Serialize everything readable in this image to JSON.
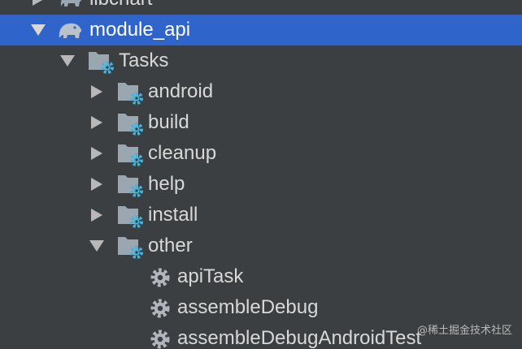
{
  "colors": {
    "background": "#3c3f41",
    "selection": "#2f65ca",
    "text": "#d8d8d8",
    "folder_icon": "#9aa7b0",
    "gear_badge": "#40b6e0"
  },
  "tree": {
    "items": [
      {
        "label": "libchart",
        "icon": "gradle-elephant-icon",
        "expanded": false
      },
      {
        "label": "module_api",
        "icon": "gradle-elephant-icon",
        "expanded": true,
        "selected": true
      },
      {
        "label": "Tasks",
        "icon": "task-folder-icon",
        "expanded": true
      },
      {
        "label": "android",
        "icon": "task-folder-icon",
        "expanded": false
      },
      {
        "label": "build",
        "icon": "task-folder-icon",
        "expanded": false
      },
      {
        "label": "cleanup",
        "icon": "task-folder-icon",
        "expanded": false
      },
      {
        "label": "help",
        "icon": "task-folder-icon",
        "expanded": false
      },
      {
        "label": "install",
        "icon": "task-folder-icon",
        "expanded": false
      },
      {
        "label": "other",
        "icon": "task-folder-icon",
        "expanded": true
      },
      {
        "label": "apiTask",
        "icon": "gear-icon"
      },
      {
        "label": "assembleDebug",
        "icon": "gear-icon"
      },
      {
        "label": "assembleDebugAndroidTest",
        "icon": "gear-icon"
      }
    ]
  },
  "watermark": "@稀土掘金技术社区"
}
